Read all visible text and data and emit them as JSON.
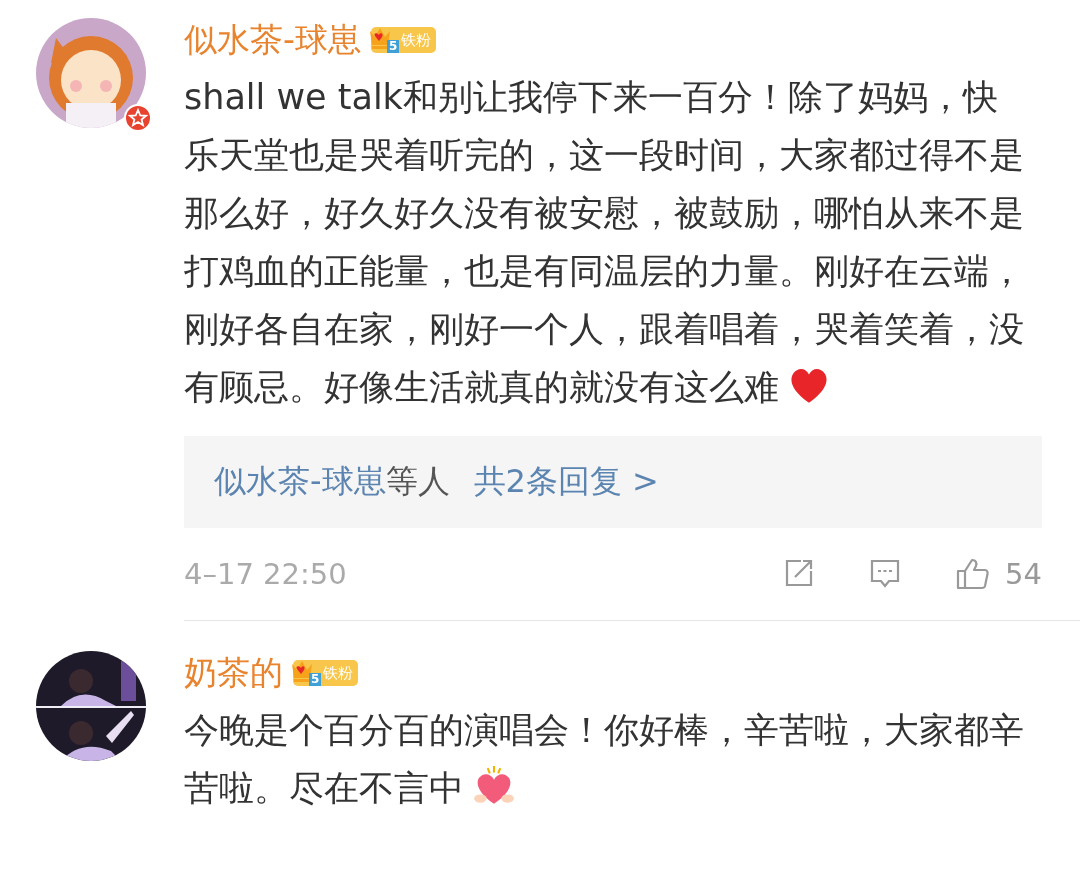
{
  "comments": [
    {
      "user": "似水茶-球崽",
      "verified": true,
      "badge": {
        "rank": "5",
        "label": "铁粉"
      },
      "text": "shall we talk和别让我停下来一百分！除了妈妈，快乐天堂也是哭着听完的，这一段时间，大家都过得不是那么好，好久好久没有被安慰，被鼓励，哪怕从来不是打鸡血的正能量，也是有同温层的力量。刚好在云端，刚好各自在家，刚好一个人，跟着唱着，哭着笑着，没有顾忌。好像生活就真的就没有这么难",
      "emoji": {
        "kind": "heart"
      },
      "replies": {
        "users": "似水茶-球崽",
        "suffix": "等人",
        "count": "共2条回复 >"
      },
      "time": "4–17 22:50",
      "likes": "54"
    },
    {
      "user": "奶茶的",
      "verified": false,
      "badge": {
        "rank": "5",
        "label": "铁粉"
      },
      "text": "今晚是个百分百的演唱会！你好棒，辛苦啦，大家都辛苦啦。尽在不言中",
      "emoji": {
        "kind": "heart-hug"
      }
    }
  ]
}
